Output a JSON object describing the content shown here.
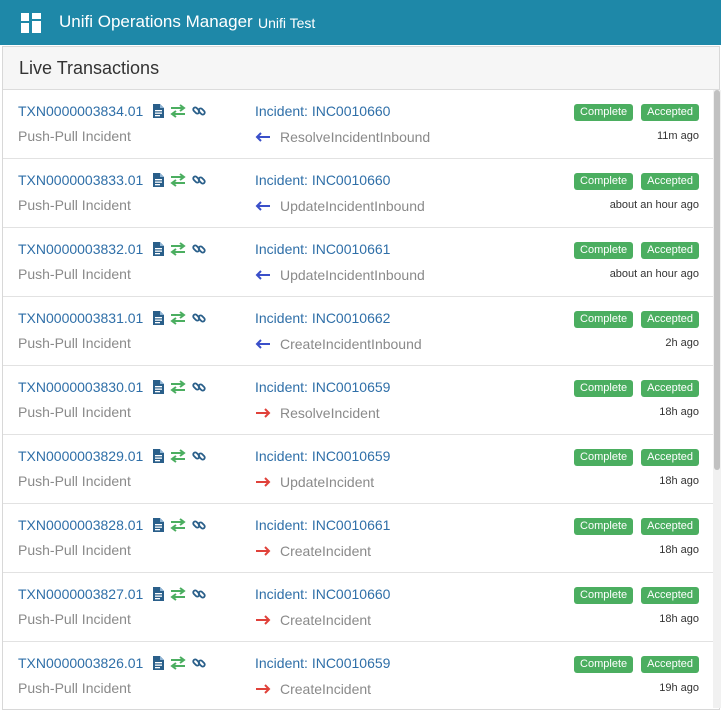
{
  "header": {
    "app_title": "Unifi Operations Manager",
    "instance": "Unifi Test",
    "color": "#1e88a8"
  },
  "panel": {
    "title": "Live Transactions"
  },
  "badge_color": "#4bae60",
  "transactions": [
    {
      "id": "TXN0000003834.01",
      "type": "Push-Pull Incident",
      "incident": "Incident: INC0010660",
      "method": "ResolveIncidentInbound",
      "direction": "inbound",
      "status": "Complete",
      "state": "Accepted",
      "time": "11m ago"
    },
    {
      "id": "TXN0000003833.01",
      "type": "Push-Pull Incident",
      "incident": "Incident: INC0010660",
      "method": "UpdateIncidentInbound",
      "direction": "inbound",
      "status": "Complete",
      "state": "Accepted",
      "time": "about an hour ago"
    },
    {
      "id": "TXN0000003832.01",
      "type": "Push-Pull Incident",
      "incident": "Incident: INC0010661",
      "method": "UpdateIncidentInbound",
      "direction": "inbound",
      "status": "Complete",
      "state": "Accepted",
      "time": "about an hour ago"
    },
    {
      "id": "TXN0000003831.01",
      "type": "Push-Pull Incident",
      "incident": "Incident: INC0010662",
      "method": "CreateIncidentInbound",
      "direction": "inbound",
      "status": "Complete",
      "state": "Accepted",
      "time": "2h ago"
    },
    {
      "id": "TXN0000003830.01",
      "type": "Push-Pull Incident",
      "incident": "Incident: INC0010659",
      "method": "ResolveIncident",
      "direction": "outbound",
      "status": "Complete",
      "state": "Accepted",
      "time": "18h ago"
    },
    {
      "id": "TXN0000003829.01",
      "type": "Push-Pull Incident",
      "incident": "Incident: INC0010659",
      "method": "UpdateIncident",
      "direction": "outbound",
      "status": "Complete",
      "state": "Accepted",
      "time": "18h ago"
    },
    {
      "id": "TXN0000003828.01",
      "type": "Push-Pull Incident",
      "incident": "Incident: INC0010661",
      "method": "CreateIncident",
      "direction": "outbound",
      "status": "Complete",
      "state": "Accepted",
      "time": "18h ago"
    },
    {
      "id": "TXN0000003827.01",
      "type": "Push-Pull Incident",
      "incident": "Incident: INC0010660",
      "method": "CreateIncident",
      "direction": "outbound",
      "status": "Complete",
      "state": "Accepted",
      "time": "18h ago"
    },
    {
      "id": "TXN0000003826.01",
      "type": "Push-Pull Incident",
      "incident": "Incident: INC0010659",
      "method": "CreateIncident",
      "direction": "outbound",
      "status": "Complete",
      "state": "Accepted",
      "time": "19h ago"
    }
  ],
  "icons": {
    "app": "grid-logo-icon",
    "document": "document-icon",
    "exchange": "exchange-arrows-icon",
    "link": "link-icon",
    "inbound_arrow": "arrow-left-icon",
    "outbound_arrow": "arrow-right-icon"
  },
  "arrow_colors": {
    "inbound": "#3a4fc9",
    "outbound": "#e0413a"
  }
}
